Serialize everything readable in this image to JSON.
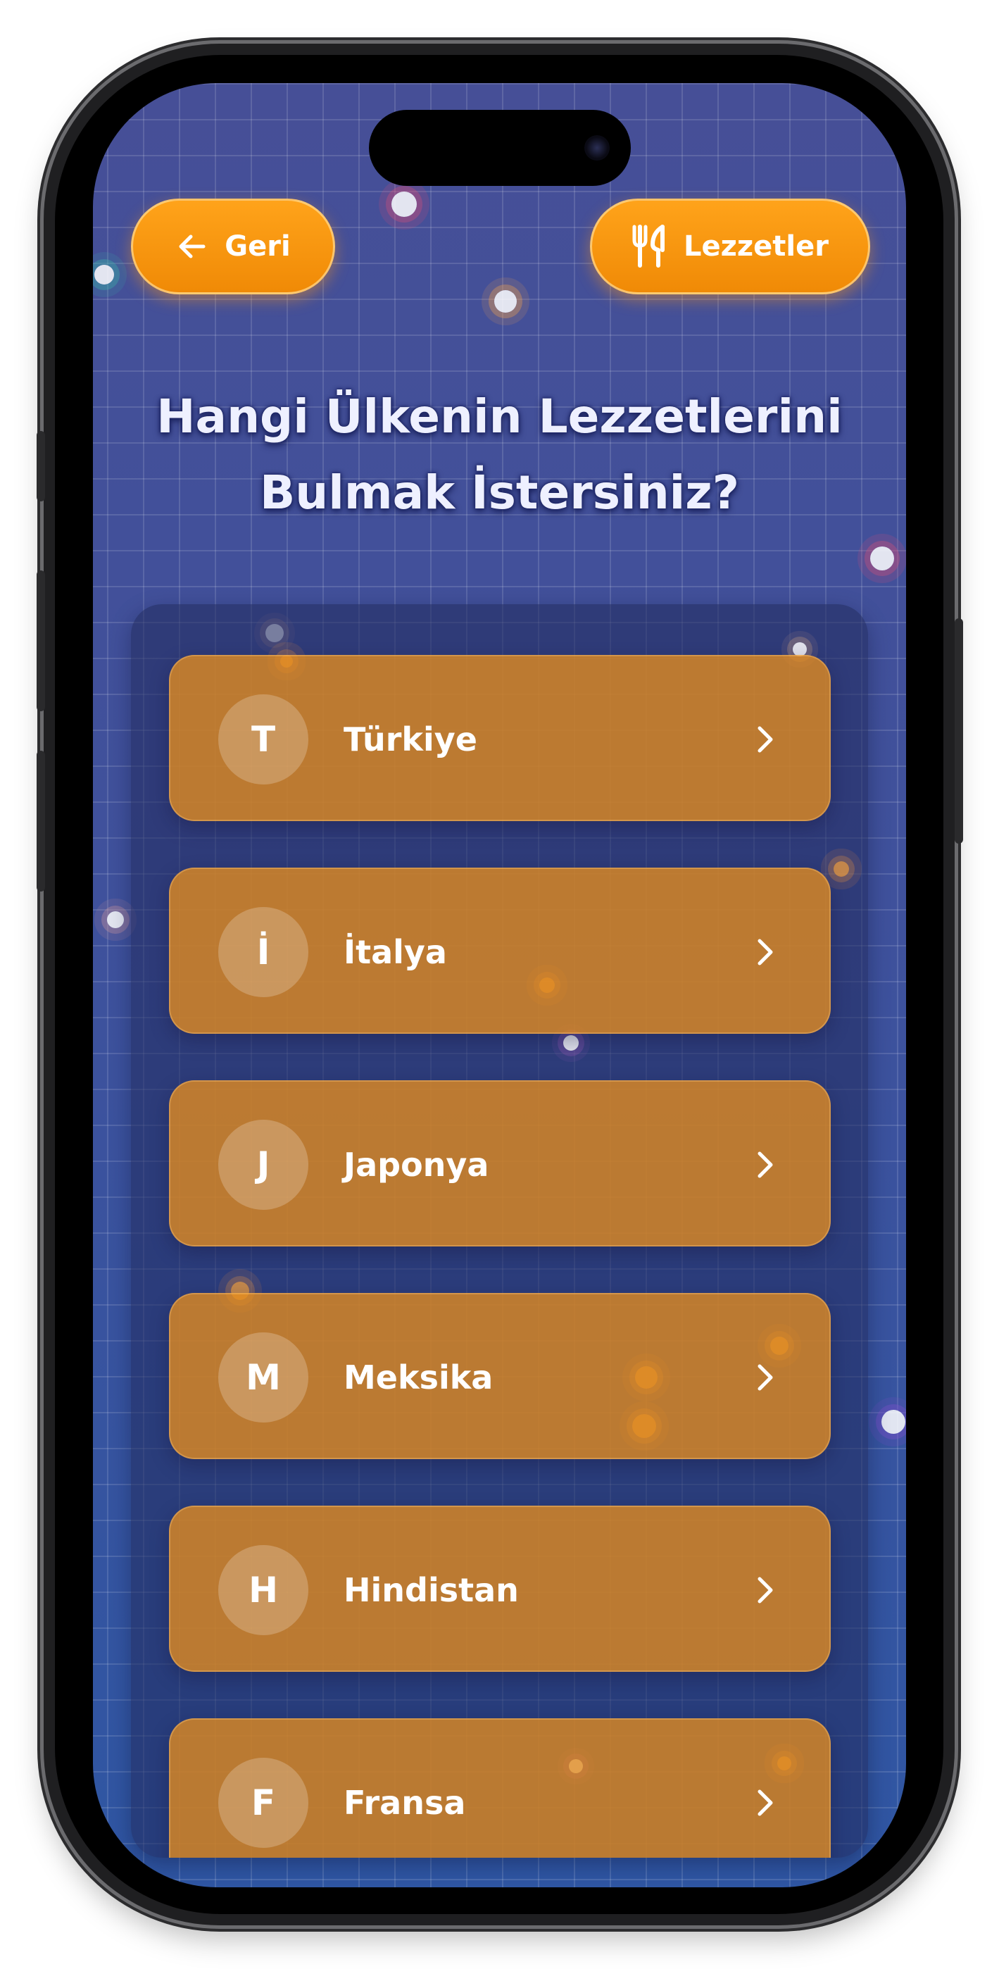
{
  "header": {
    "back_label": "Geri",
    "back_icon": "arrow-left-icon",
    "dishes_label": "Lezzetler",
    "dishes_icon": "fork-knife-icon"
  },
  "title": {
    "line1": "Hangi Ülkenin Lezzetlerini",
    "line2": "Bulmak İstersiniz?"
  },
  "countries": [
    {
      "initial": "T",
      "name": "Türkiye"
    },
    {
      "initial": "İ",
      "name": "İtalya"
    },
    {
      "initial": "J",
      "name": "Japonya"
    },
    {
      "initial": "M",
      "name": "Meksika"
    },
    {
      "initial": "H",
      "name": "Hindistan"
    },
    {
      "initial": "F",
      "name": "Fransa"
    }
  ],
  "colors": {
    "accent": "#f7930e",
    "background_top": "#464f97",
    "background_bottom": "#2f56a3",
    "card": "#e48c1e"
  }
}
